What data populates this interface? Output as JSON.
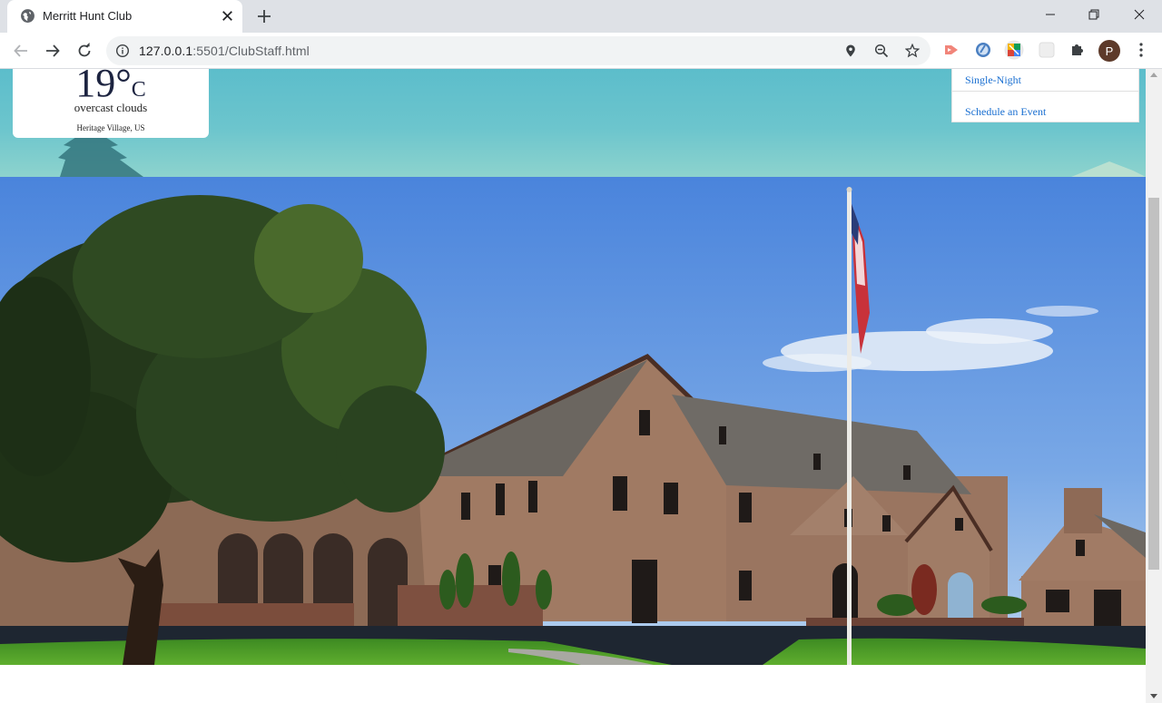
{
  "browser": {
    "tab_title": "Merritt Hunt Club",
    "url_host": "127.0.0.1",
    "url_path": ":5501/ClubStaff.html",
    "profile_initial": "P"
  },
  "weather": {
    "temp_value": "19°",
    "temp_unit": "C",
    "description": "overcast clouds",
    "location": "Heritage Village, US"
  },
  "menu": {
    "items": [
      {
        "label": "Single-Night"
      },
      {
        "label": "Schedule an Event"
      }
    ]
  },
  "colors": {
    "sky_top": "#5cbdcb",
    "link": "#1a6fd1",
    "weather_text": "#1c2340"
  },
  "icons": {
    "tab": "globe-icon",
    "close": "close-icon",
    "new_tab": "plus-icon",
    "back": "back-arrow-icon",
    "forward": "forward-arrow-icon",
    "reload": "reload-icon",
    "site_info": "info-icon",
    "location": "location-pin-icon",
    "zoom": "zoom-out-icon",
    "bookmark": "star-icon",
    "extensions": "puzzle-icon",
    "menu": "kebab-menu-icon"
  }
}
